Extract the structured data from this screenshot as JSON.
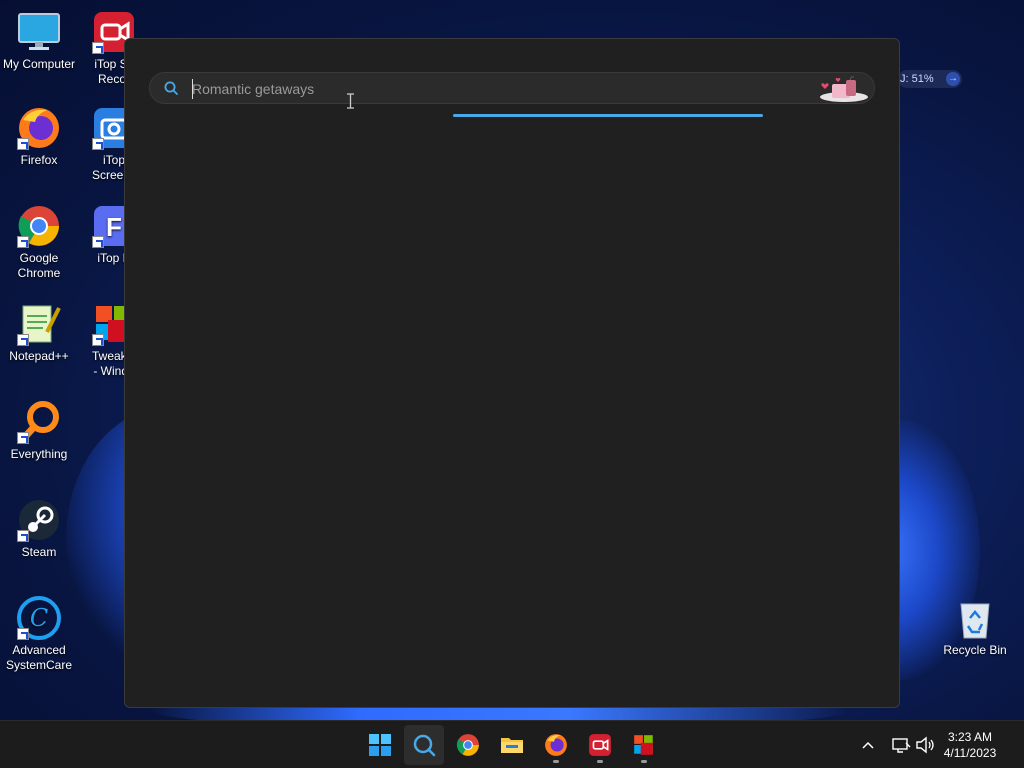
{
  "desktop": {
    "icons": [
      {
        "label": "My Computer"
      },
      {
        "label": "iTop Sc\nRecor"
      },
      {
        "label": "Firefox"
      },
      {
        "label": "iTop\nScreens"
      },
      {
        "label": "Google\nChrome"
      },
      {
        "label": "iTop P"
      },
      {
        "label": "Notepad++"
      },
      {
        "label": "Tweakin\n- Windo"
      },
      {
        "label": "Everything"
      },
      {
        "label": "Steam"
      },
      {
        "label": "Advanced\nSystemCare"
      },
      {
        "label": "Recycle Bin"
      }
    ],
    "widget_text": "J: 51%"
  },
  "search": {
    "placeholder": "Romantic getaways",
    "value": ""
  },
  "taskbar": {
    "apps": [
      "start",
      "search",
      "chrome",
      "file-explorer",
      "firefox",
      "itop-recorder",
      "tweaking"
    ],
    "time": "3:23 AM",
    "date": "4/11/2023"
  },
  "colors": {
    "accent": "#4aa8e8",
    "window_bg": "#202020",
    "taskbar_bg": "#1c1c1c"
  }
}
